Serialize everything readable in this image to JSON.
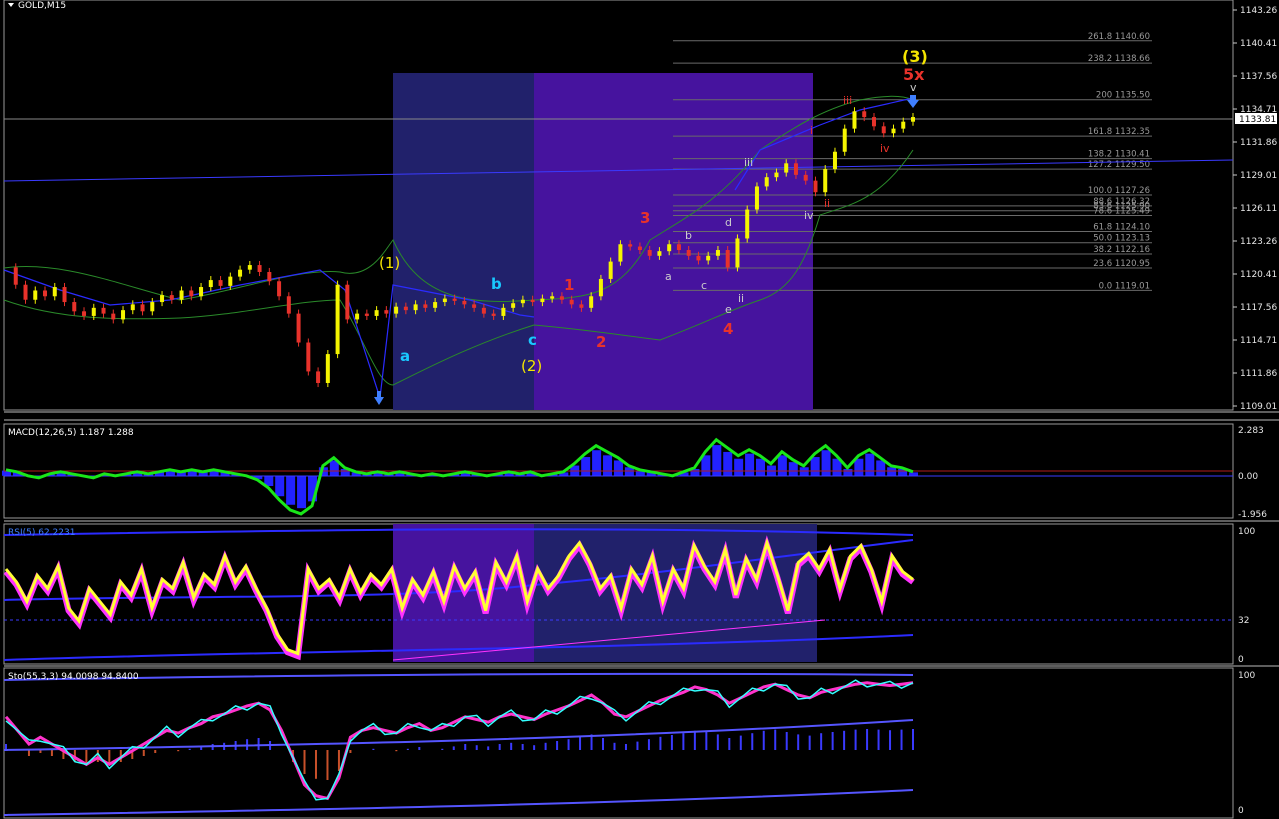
{
  "chart_title": "GOLD,M15",
  "colors": {
    "background": "#000000",
    "bull_candle": "#f5f500",
    "bear_candle": "#e8322b",
    "box_blue": "#21216b",
    "box_purple": "#46139e",
    "macd_line": "#19e619",
    "macd_hist": "#2222ff",
    "rsi_line": "#ffff33",
    "rsi_shadow": "#ff33ff",
    "grid": "#5a5a5a"
  },
  "price_axis": {
    "ticks": [
      "1143.26",
      "1140.41",
      "1137.56",
      "1134.71",
      "1131.86",
      "1129.01",
      "1126.11",
      "1123.26",
      "1120.41",
      "1117.56",
      "1114.71",
      "1111.86",
      "1109.01"
    ],
    "current_price": "1133.81"
  },
  "fib_levels": [
    {
      "ratio": "261.8",
      "price": "1140.60",
      "value": 1140.6
    },
    {
      "ratio": "238.2",
      "price": "1138.66",
      "value": 1138.66
    },
    {
      "ratio": "200",
      "price": "1135.50",
      "value": 1135.5
    },
    {
      "ratio": "161.8",
      "price": "1132.35",
      "value": 1132.35
    },
    {
      "ratio": "138.2",
      "price": "1130.41",
      "value": 1130.41
    },
    {
      "ratio": "127.2",
      "price": "1129.50",
      "value": 1129.5
    },
    {
      "ratio": "100.0",
      "price": "1127.26",
      "value": 1127.26
    },
    {
      "ratio": "88.6",
      "price": "1126.32",
      "value": 1126.32
    },
    {
      "ratio": "83.6",
      "price": "1125.90",
      "value": 1125.9
    },
    {
      "ratio": "78.6",
      "price": "1125.49",
      "value": 1125.49
    },
    {
      "ratio": "61.8",
      "price": "1124.10",
      "value": 1124.1
    },
    {
      "ratio": "50.0",
      "price": "1123.13",
      "value": 1123.13
    },
    {
      "ratio": "38.2",
      "price": "1122.16",
      "value": 1122.16
    },
    {
      "ratio": "23.6",
      "price": "1120.95",
      "value": 1120.95
    },
    {
      "ratio": "0.0",
      "price": "1119.01",
      "value": 1119.01
    }
  ],
  "wave_labels": {
    "w1": "(1)",
    "wa": "a",
    "wb": "b",
    "wc": "c",
    "w2": "(2)",
    "r1": "1",
    "r2": "2",
    "r3": "3",
    "r4": "4",
    "w3": "(3)",
    "w5x": "5x",
    "sa": "a",
    "sb": "b",
    "sc": "c",
    "sd": "d",
    "se": "e",
    "iii_white": "iii",
    "ii_white": "ii",
    "i_red": "i",
    "ii_red": "ii",
    "iii_red": "iii",
    "iv_red": "iv",
    "iv_white": "iv",
    "v_white": "v"
  },
  "macd": {
    "title": "MACD(12,26,5) 1.187 1.288",
    "ticks": [
      "2.283",
      "0.00",
      "-1.956"
    ]
  },
  "rsi": {
    "title": "RSI(5) 62.2231",
    "ticks": [
      "100",
      "32",
      "0"
    ]
  },
  "stochastic": {
    "title": "Sto(55,3,3) 94.0098 94.8400",
    "ticks": [
      "100",
      "0"
    ]
  },
  "chart_data": [
    {
      "type": "line",
      "title": "GOLD,M15",
      "ylim": [
        1109.01,
        1143.26
      ],
      "series": [
        {
          "name": "GOLD",
          "y": [
            1121.0,
            1119.5,
            1118.2,
            1119.0,
            1118.5,
            1119.3,
            1118.0,
            1117.2,
            1116.8,
            1117.5,
            1117.0,
            1116.5,
            1117.3,
            1117.8,
            1117.2,
            1118.0,
            1118.6,
            1118.2,
            1119.0,
            1118.5,
            1119.3,
            1119.9,
            1119.4,
            1120.2,
            1120.8,
            1121.2,
            1120.6,
            1119.8,
            1118.5,
            1117.0,
            1114.5,
            1112.0,
            1111.0,
            1113.5,
            1119.5,
            1116.5,
            1117.0,
            1116.8,
            1117.3,
            1117.0,
            1117.6,
            1117.3,
            1117.8,
            1117.5,
            1118.0,
            1118.3,
            1118.1,
            1117.8,
            1117.5,
            1117.0,
            1116.8,
            1117.5,
            1117.9,
            1118.2,
            1118.0,
            1118.3,
            1118.5,
            1118.2,
            1117.8,
            1117.5,
            1118.5,
            1120.0,
            1121.5,
            1123.0,
            1122.8,
            1122.5,
            1122.0,
            1122.4,
            1123.0,
            1122.5,
            1122.0,
            1121.6,
            1122.0,
            1122.5,
            1121.0,
            1123.5,
            1126.0,
            1128.0,
            1128.8,
            1129.2,
            1130.0,
            1129.0,
            1128.5,
            1127.5,
            1129.5,
            1131.0,
            1133.0,
            1134.5,
            1134.0,
            1133.2,
            1132.6,
            1133.0,
            1133.6,
            1134.0
          ]
        }
      ]
    },
    {
      "type": "line",
      "title": "MACD(12,26,5) 1.187 1.288",
      "ylim": [
        -1.956,
        2.283
      ],
      "series": [
        {
          "name": "MACD",
          "y": [
            0.3,
            0.2,
            0.0,
            -0.1,
            0.1,
            0.2,
            0.1,
            0.0,
            -0.1,
            0.1,
            0.0,
            0.1,
            0.2,
            0.1,
            0.2,
            0.3,
            0.2,
            0.3,
            0.2,
            0.3,
            0.2,
            0.1,
            0.0,
            -0.2,
            -0.6,
            -1.2,
            -1.7,
            -1.9,
            -1.5,
            0.5,
            0.9,
            0.4,
            0.2,
            0.1,
            0.2,
            0.1,
            0.2,
            0.1,
            0.0,
            0.1,
            0.0,
            0.1,
            0.2,
            0.1,
            0.0,
            0.1,
            0.2,
            0.1,
            0.2,
            0.0,
            0.1,
            0.2,
            0.6,
            1.1,
            1.5,
            1.2,
            0.9,
            0.5,
            0.3,
            0.2,
            0.1,
            0.0,
            0.2,
            0.4,
            1.2,
            1.8,
            1.4,
            1.0,
            1.3,
            1.0,
            0.6,
            1.2,
            0.8,
            0.5,
            1.1,
            1.5,
            1.0,
            0.4,
            1.0,
            1.3,
            0.9,
            0.5,
            0.4,
            0.2
          ]
        }
      ]
    },
    {
      "type": "line",
      "title": "RSI(5) 62.2231",
      "ylim": [
        0,
        100
      ],
      "series": [
        {
          "name": "RSI",
          "y": [
            70,
            60,
            45,
            65,
            55,
            72,
            40,
            30,
            55,
            45,
            35,
            60,
            50,
            70,
            40,
            62,
            55,
            75,
            48,
            66,
            58,
            80,
            60,
            72,
            55,
            40,
            20,
            8,
            5,
            70,
            55,
            62,
            48,
            70,
            52,
            66,
            58,
            70,
            40,
            62,
            50,
            68,
            45,
            72,
            55,
            68,
            38,
            75,
            60,
            80,
            45,
            70,
            55,
            65,
            80,
            90,
            75,
            55,
            65,
            40,
            70,
            58,
            80,
            45,
            70,
            55,
            88,
            72,
            60,
            85,
            50,
            78,
            62,
            90,
            65,
            38,
            75,
            82,
            70,
            85,
            55,
            80,
            88,
            70,
            45,
            80,
            68,
            62
          ]
        }
      ]
    },
    {
      "type": "line",
      "title": "Sto(55,3,3) 94.0098 94.8400",
      "ylim": [
        0,
        100
      ],
      "series": [
        {
          "name": "Sto",
          "y": [
            70,
            60,
            50,
            55,
            50,
            45,
            40,
            35,
            40,
            35,
            40,
            45,
            50,
            55,
            60,
            58,
            62,
            65,
            70,
            72,
            75,
            78,
            80,
            75,
            60,
            40,
            20,
            12,
            10,
            25,
            55,
            60,
            62,
            60,
            58,
            62,
            65,
            60,
            62,
            66,
            70,
            68,
            66,
            70,
            72,
            70,
            68,
            72,
            75,
            78,
            82,
            86,
            80,
            72,
            70,
            74,
            78,
            82,
            85,
            88,
            92,
            90,
            86,
            80,
            84,
            88,
            92,
            94,
            90,
            86,
            84,
            88,
            90,
            92,
            94,
            95,
            94,
            93,
            94,
            95
          ]
        }
      ]
    }
  ]
}
